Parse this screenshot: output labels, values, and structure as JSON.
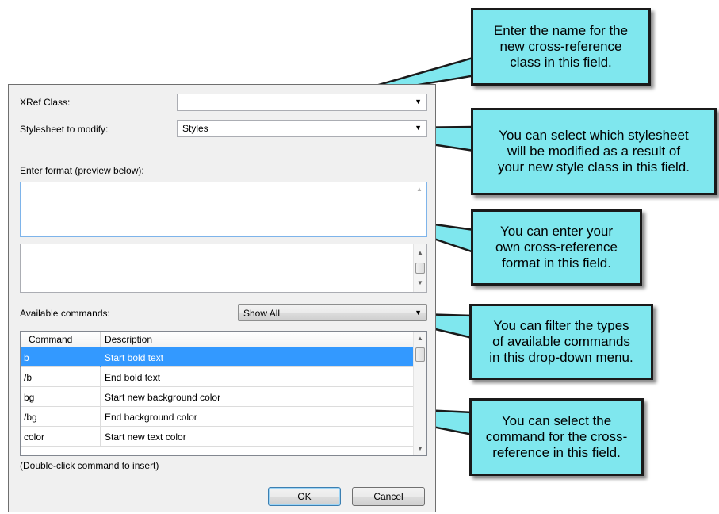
{
  "dialog": {
    "xref_class_label": "XRef Class:",
    "xref_class_value": "",
    "stylesheet_label": "Stylesheet to modify:",
    "stylesheet_value": "Styles",
    "enter_format_label": "Enter format (preview below):",
    "available_commands_label": "Available commands:",
    "filter_value": "Show All",
    "table": {
      "headers": [
        "Command",
        "Description"
      ],
      "rows": [
        {
          "command": "b",
          "description": "Start bold text",
          "selected": true
        },
        {
          "command": "/b",
          "description": "End bold text"
        },
        {
          "command": "bg",
          "description": "Start new background color"
        },
        {
          "command": "/bg",
          "description": "End background color"
        },
        {
          "command": "color",
          "description": "Start new text color"
        }
      ]
    },
    "hint": "(Double-click command to insert)",
    "ok_label": "OK",
    "cancel_label": "Cancel"
  },
  "callouts": [
    {
      "text": "Enter the name for the\nnew cross-reference\nclass in this field."
    },
    {
      "text": "You can select which stylesheet\nwill be modified as a result of\nyour new style class in this field."
    },
    {
      "text": "You can enter your\nown cross-reference\nformat in this field."
    },
    {
      "text": "You can filter the types\nof available commands\nin this drop-down menu."
    },
    {
      "text": "You can select the\ncommand for the cross-\nreference in this field."
    }
  ],
  "colors": {
    "callout_fill": "#7fe7ee",
    "selection": "#3399ff"
  }
}
